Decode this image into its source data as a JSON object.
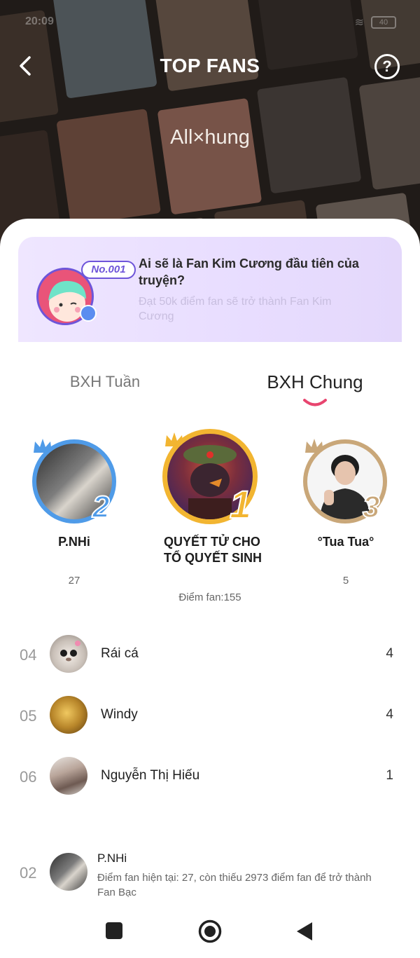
{
  "status": {
    "time": "20:09",
    "battery": "40"
  },
  "header": {
    "title": "TOP FANS",
    "story_title": "All×hung",
    "help_label": "?"
  },
  "banner": {
    "badge": "No.001",
    "title": "Ai sẽ là Fan Kim Cương đầu tiên của truyện?",
    "subtitle": "Đạt 50k điểm fan sẽ trở thành Fan Kim Cương"
  },
  "tabs": [
    {
      "label": "BXH Tuần",
      "active": false
    },
    {
      "label": "BXH Chung",
      "active": true
    }
  ],
  "podium": {
    "first": {
      "rank": "1",
      "name": "QUYẾT TỬ CHO TỔ QUYẾT SINH",
      "score": "Điểm fan:155"
    },
    "second": {
      "rank": "2",
      "name": "P.NHi",
      "score": "27"
    },
    "third": {
      "rank": "3",
      "name": "°Tua Tua°",
      "score": "5"
    }
  },
  "ranking": [
    {
      "rank": "04",
      "name": "Rái cá",
      "score": "4"
    },
    {
      "rank": "05",
      "name": "Windy",
      "score": "4"
    },
    {
      "rank": "06",
      "name": "Nguyễn Thị Hiếu",
      "score": "1"
    }
  ],
  "me": {
    "rank": "02",
    "name": "P.NHi",
    "description": "Điểm fan hiện tại: 27, còn thiếu 2973 điểm fan để trở thành Fan Bạc"
  },
  "colors": {
    "accent": "#e8456f",
    "gold": "#f2b531",
    "silver": "#4f9be8",
    "bronze": "#c9a779",
    "banner_purple": "#6e55d9"
  }
}
